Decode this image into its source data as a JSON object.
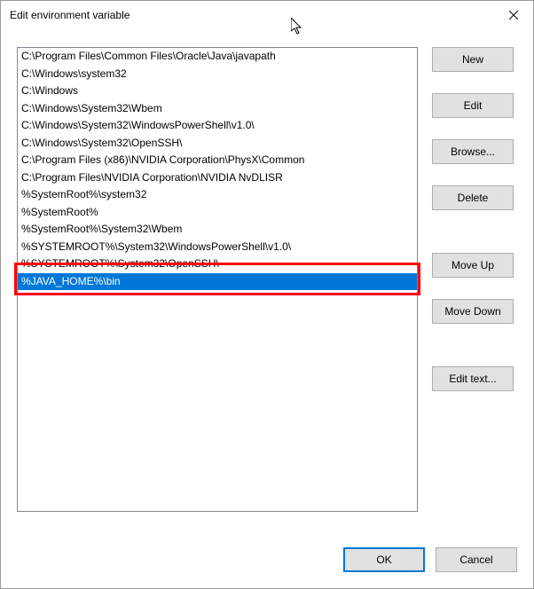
{
  "titlebar": {
    "title": "Edit environment variable"
  },
  "list": {
    "items": [
      "C:\\Program Files\\Common Files\\Oracle\\Java\\javapath",
      "C:\\Windows\\system32",
      "C:\\Windows",
      "C:\\Windows\\System32\\Wbem",
      "C:\\Windows\\System32\\WindowsPowerShell\\v1.0\\",
      "C:\\Windows\\System32\\OpenSSH\\",
      "C:\\Program Files (x86)\\NVIDIA Corporation\\PhysX\\Common",
      "C:\\Program Files\\NVIDIA Corporation\\NVIDIA NvDLISR",
      "%SystemRoot%\\system32",
      "%SystemRoot%",
      "%SystemRoot%\\System32\\Wbem",
      "%SYSTEMROOT%\\System32\\WindowsPowerShell\\v1.0\\",
      "%SYSTEMROOT%\\System32\\OpenSSH\\",
      "%JAVA_HOME%\\bin"
    ],
    "selected_index": 13,
    "highlighted_index": 13
  },
  "buttons": {
    "new": "New",
    "edit": "Edit",
    "browse": "Browse...",
    "delete": "Delete",
    "move_up": "Move Up",
    "move_down": "Move Down",
    "edit_text": "Edit text...",
    "ok": "OK",
    "cancel": "Cancel"
  }
}
